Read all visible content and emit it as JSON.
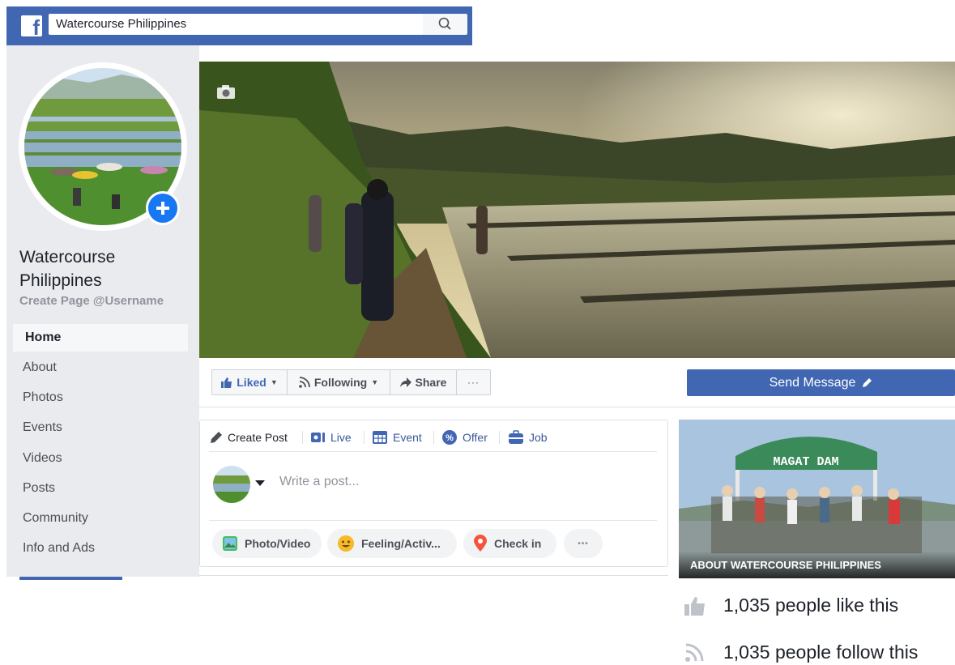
{
  "topbar": {
    "logo_letter": "f",
    "search_value": "Watercourse Philippines"
  },
  "page": {
    "name": "Watercourse Philippines",
    "username_link": "Create Page @Username"
  },
  "nav": {
    "items": [
      "Home",
      "About",
      "Photos",
      "Events",
      "Videos",
      "Posts",
      "Community",
      "Info and Ads"
    ],
    "active": "Home"
  },
  "actions": {
    "liked": "Liked",
    "following": "Following",
    "share": "Share",
    "more": "···",
    "send_message": "Send Message"
  },
  "composer": {
    "tabs": [
      "Create Post",
      "Live",
      "Event",
      "Offer",
      "Job"
    ],
    "placeholder": "Write a post...",
    "pills": [
      "Photo/Video",
      "Feeling/Activ...",
      "Check in"
    ],
    "more": "•••"
  },
  "about": {
    "label": "ABOUT WATERCOURSE PHILIPPINES",
    "sign_text": "MAGAT DAM"
  },
  "stats": {
    "likes": "1,035 people like this",
    "follows": "1,035 people follow this"
  },
  "colors": {
    "brand": "#4267b2",
    "link": "#385898",
    "bg_gray": "#e9ebee"
  }
}
